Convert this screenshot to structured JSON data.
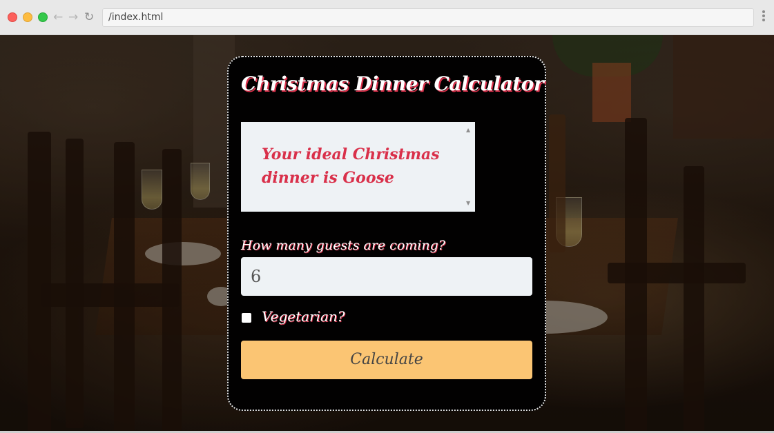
{
  "browser": {
    "address": "/index.html",
    "back_icon": "arrow-left-icon",
    "forward_icon": "arrow-right-icon",
    "reload_icon": "reload-icon",
    "menu_icon": "kebab-menu-icon"
  },
  "app": {
    "title": "Christmas Dinner Calculator",
    "result": "Your ideal Christmas dinner is Goose",
    "guests_label": "How many guests are coming?",
    "guests_value": "6",
    "vegetarian_label": "Vegetarian?",
    "vegetarian_checked": false,
    "calculate_label": "Calculate"
  },
  "colors": {
    "accent_red": "#d9304a",
    "button_orange": "#fbc573",
    "field_background": "#eef2f5",
    "card_background": "#020101"
  }
}
